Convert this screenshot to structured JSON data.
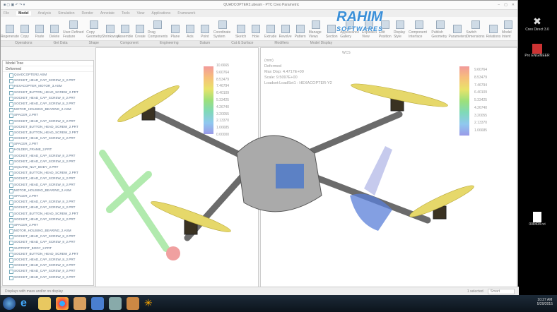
{
  "window": {
    "title": "QUADCOPTER2.ubeam - PTC Creo Parametric",
    "tabs": [
      "File",
      "Model",
      "Analysis",
      "Simulation",
      "Render",
      "Annotate",
      "Tools",
      "View",
      "Applications",
      "Framework"
    ],
    "active_tab": "Model"
  },
  "ribbon": {
    "buttons": [
      "Regenerate",
      "Copy",
      "Paste",
      "Delete",
      "User-Defined Feature",
      "Copy Geometry",
      "Shrinkwrap",
      "Assemble",
      "Create",
      "Drag Components",
      "Plane",
      "Axis",
      "Point",
      "Coordinate System",
      "Sketch",
      "Hole",
      "Extrude",
      "Revolve",
      "Pattern",
      "Manage Views",
      "Section",
      "Appearance Gallery",
      "Exploded View",
      "Edit Position",
      "Display Style",
      "Component Interface",
      "Publish Geometry",
      "Parameters",
      "Switch Dimensions",
      "Relations",
      "Model Intent"
    ],
    "groups": [
      "Operations",
      "Get Data",
      "Shape",
      "Component",
      "Engineering",
      "Datum",
      "Cut & Surface",
      "Modifiers",
      "Model Display"
    ]
  },
  "model_tree": {
    "header": "Model Tree",
    "filter": "Deformed",
    "items": [
      "QUADCOPTER2.ASM",
      "SOCKET_HEAD_CAP_SCREW_8_2.PRT",
      "HEXACOPTER_MOTOR_3.ASM",
      "SOCKET_BUTTON_HEAD_SCREW_2.PRT",
      "SOCKET_HEAD_CAP_SCREW_8_2.PRT",
      "SOCKET_HEAD_CAP_SCREW_8_2.PRT",
      "MOTOR_HOUSING_BEARING_2.ASM",
      "SPACER_2.PRT",
      "SOCKET_HEAD_CAP_SCREW_8_2.PRT",
      "SOCKET_BUTTON_HEAD_SCREW_2.PRT",
      "SOCKET_BUTTON_HEAD_SCREW_2.PRT",
      "SOCKET_HEAD_CAP_SCREW_8_2.PRT",
      "SPACER_2.PRT",
      "HOLDER_FRAME_2.PRT",
      "SOCKET_HEAD_CAP_SCREW_8_2.PRT",
      "SOCKET_HEAD_CAP_SCREW_8_2.PRT",
      "SQUARE_NUT_BODY_2.PRT",
      "SOCKET_BUTTON_HEAD_SCREW_2.PRT",
      "SOCKET_HEAD_CAP_SCREW_8_2.PRT",
      "SOCKET_HEAD_CAP_SCREW_8_2.PRT",
      "MOTOR_HOUSING_BEARING_2.ASM",
      "SPACER_2.PRT",
      "SOCKET_HEAD_CAP_SCREW_8_2.PRT",
      "SOCKET_HEAD_CAP_SCREW_8_2.PRT",
      "SOCKET_BUTTON_HEAD_SCREW_2.PRT",
      "SOCKET_HEAD_CAP_SCREW_8_2.PRT",
      "SPACER_2.PRT",
      "MOTOR_HOUSING_BEARING_2.ASM",
      "SOCKET_HEAD_CAP_SCREW_8_2.PRT",
      "SOCKET_HEAD_CAP_SCREW_8_2.PRT",
      "SUPPORT_BODY_2.PRT",
      "SOCKET_BUTTON_HEAD_SCREW_2.PRT",
      "SOCKET_HEAD_CAP_SCREW_8_2.PRT",
      "SOCKET_HEAD_CAP_SCREW_8_2.PRT",
      "SOCKET_HEAD_CAP_SCREW_8_2.PRT",
      "SOCKET_HEAD_CAP_SCREW_8_2.PRT"
    ]
  },
  "viewport_left": {
    "legend": [
      "10.6665",
      "9.60764",
      "8.53479",
      "7.46794",
      "6.40109",
      "5.33425",
      "4.26740",
      "3.20055",
      "2.13370",
      "1.06685",
      "0.00000"
    ]
  },
  "viewport_right": {
    "info": [
      "(mm)",
      "Deformed",
      "Max Disp: 4.4717E+00",
      "Scale: 9.5097E+00",
      "Loadset:LoadSet1 : HEXACOPTER-Y2"
    ],
    "csys": "WCS",
    "legend": [
      "9.60764",
      "8.53479",
      "7.46794",
      "6.40109",
      "5.33425",
      "4.26740",
      "3.20055",
      "2.13370",
      "1.06685"
    ]
  },
  "status": {
    "message": "Displays with mass and/or on display",
    "selected": "1 selected",
    "filter": "Smart"
  },
  "desktop": {
    "icons": [
      "Creo Direct 3.0",
      "Pro ENGINEER"
    ],
    "file": "008408.rvi"
  },
  "taskbar": {
    "time": "10:27 AM",
    "date": "5/29/2015"
  },
  "watermark": {
    "line1": "RAHIM",
    "line2": "SOFTWARES"
  }
}
